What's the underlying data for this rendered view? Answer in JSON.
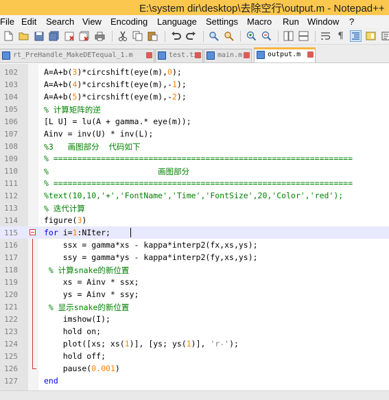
{
  "window": {
    "title": "E:\\system dir\\desktop\\去除空行\\output.m - Notepad++"
  },
  "menu": [
    "File",
    "Edit",
    "Search",
    "View",
    "Encoding",
    "Language",
    "Settings",
    "Macro",
    "Run",
    "Window",
    "?"
  ],
  "tabs": [
    {
      "label": "rt_PreHandle_MakeDETequal_1.m",
      "active": false
    },
    {
      "label": "test.txt",
      "active": false
    },
    {
      "label": "main.m",
      "active": false
    },
    {
      "label": "output.m",
      "active": true
    }
  ],
  "editor": {
    "current_line": 115,
    "lines": [
      {
        "n": "102",
        "parts": [
          [
            "t",
            "A=A+b("
          ],
          [
            "n",
            "3"
          ],
          [
            "t",
            ")*circshift(eye(m),"
          ],
          [
            "n",
            "0"
          ],
          [
            "t",
            ");"
          ]
        ]
      },
      {
        "n": "103",
        "parts": [
          [
            "t",
            "A=A+b("
          ],
          [
            "n",
            "4"
          ],
          [
            "t",
            ")*circshift(eye(m),-"
          ],
          [
            "n",
            "1"
          ],
          [
            "t",
            ");"
          ]
        ]
      },
      {
        "n": "104",
        "parts": [
          [
            "t",
            "A=A+b("
          ],
          [
            "n",
            "5"
          ],
          [
            "t",
            ")*circshift(eye(m),-"
          ],
          [
            "n",
            "2"
          ],
          [
            "t",
            ");"
          ]
        ]
      },
      {
        "n": "105",
        "parts": [
          [
            "c",
            "% 计算矩阵的逆"
          ]
        ]
      },
      {
        "n": "106",
        "parts": [
          [
            "t",
            "[L U] = lu(A + gamma.* eye(m));"
          ]
        ]
      },
      {
        "n": "107",
        "parts": [
          [
            "t",
            "Ainv = inv(U) * inv(L);"
          ]
        ]
      },
      {
        "n": "108",
        "parts": [
          [
            "c",
            "%3   画图部分  代码如下"
          ]
        ]
      },
      {
        "n": "109",
        "parts": [
          [
            "c",
            "% ==============================================================="
          ]
        ]
      },
      {
        "n": "110",
        "parts": [
          [
            "c",
            "%                       画图部分"
          ]
        ]
      },
      {
        "n": "111",
        "parts": [
          [
            "c",
            "% ==============================================================="
          ]
        ]
      },
      {
        "n": "112",
        "parts": [
          [
            "c",
            "%text(10,10,'+','FontName','Time','FontSize',20,'Color','red');"
          ]
        ]
      },
      {
        "n": "113",
        "parts": [
          [
            "c",
            "% 迭代计算"
          ]
        ]
      },
      {
        "n": "114",
        "parts": [
          [
            "t",
            "figure("
          ],
          [
            "n",
            "3"
          ],
          [
            "t",
            ")"
          ]
        ]
      },
      {
        "n": "115",
        "parts": [
          [
            "k",
            "for"
          ],
          [
            "t",
            " i="
          ],
          [
            "n",
            "1"
          ],
          [
            "t",
            ":NIter;"
          ]
        ]
      },
      {
        "n": "116",
        "parts": [
          [
            "t",
            "    ssx = gamma*xs - kappa*interp2(fx,xs,ys);"
          ]
        ]
      },
      {
        "n": "117",
        "parts": [
          [
            "t",
            "    ssy = gamma*ys - kappa*interp2(fy,xs,ys);"
          ]
        ]
      },
      {
        "n": "118",
        "parts": [
          [
            "c",
            " % 计算snake的新位置"
          ]
        ]
      },
      {
        "n": "119",
        "parts": [
          [
            "t",
            "    xs = Ainv * ssx;"
          ]
        ]
      },
      {
        "n": "120",
        "parts": [
          [
            "t",
            "    ys = Ainv * ssy;"
          ]
        ]
      },
      {
        "n": "121",
        "parts": [
          [
            "c",
            " % 显示snake的新位置"
          ]
        ]
      },
      {
        "n": "122",
        "parts": [
          [
            "t",
            "    imshow(I);"
          ]
        ]
      },
      {
        "n": "123",
        "parts": [
          [
            "t",
            "    hold on;"
          ]
        ]
      },
      {
        "n": "124",
        "parts": [
          [
            "t",
            "    plot([xs; xs("
          ],
          [
            "n",
            "1"
          ],
          [
            "t",
            ")], [ys; ys("
          ],
          [
            "n",
            "1"
          ],
          [
            "t",
            ")], "
          ],
          [
            "s",
            "'r-'"
          ],
          [
            "t",
            ");"
          ]
        ]
      },
      {
        "n": "125",
        "parts": [
          [
            "t",
            "    hold off;"
          ]
        ]
      },
      {
        "n": "126",
        "parts": [
          [
            "t",
            "    pause("
          ],
          [
            "n",
            "0.001"
          ],
          [
            "t",
            ")"
          ]
        ]
      },
      {
        "n": "127",
        "parts": [
          [
            "k",
            "end"
          ]
        ]
      }
    ]
  },
  "colors": {
    "title_bar": "#fbc74e",
    "keyword": "#0000ff",
    "number": "#ff8000",
    "comment": "#008000",
    "string": "#808080",
    "current_line": "#e8e8ff",
    "fold_marker": "#d0342c"
  },
  "toolbar_icons": [
    "new-file-icon",
    "open-file-icon",
    "save-icon",
    "save-all-icon",
    "close-icon",
    "close-all-icon",
    "print-icon",
    "cut-icon",
    "copy-icon",
    "paste-icon",
    "undo-icon",
    "redo-icon",
    "find-icon",
    "replace-icon",
    "zoom-in-icon",
    "zoom-out-icon",
    "sync-v-icon",
    "sync-h-icon",
    "word-wrap-icon",
    "all-chars-icon",
    "indent-guide-icon",
    "doc-map-icon",
    "func-list-icon"
  ]
}
